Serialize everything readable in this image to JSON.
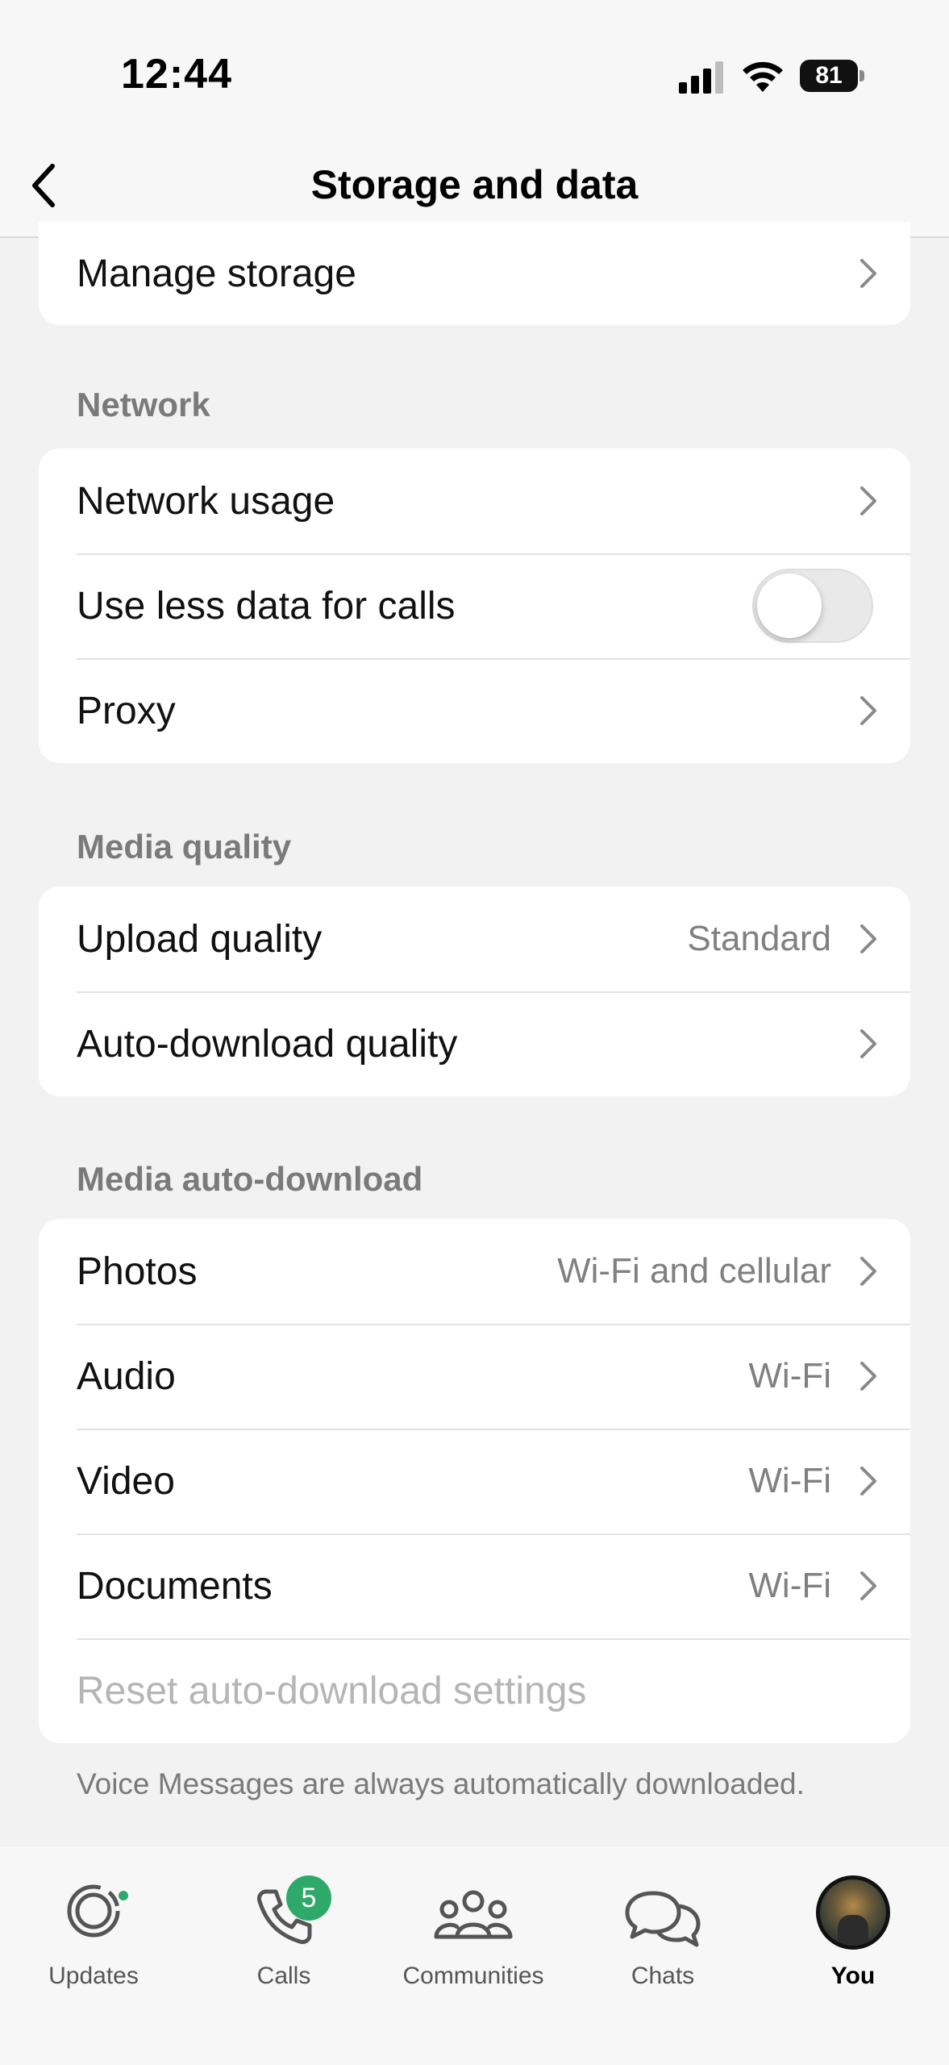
{
  "status_bar": {
    "time": "12:44",
    "battery": "81",
    "icons": [
      "signal-icon",
      "wifi-icon",
      "battery-icon"
    ]
  },
  "nav": {
    "title": "Storage and data",
    "back_icon": "chevron-left-icon"
  },
  "storage_section": {
    "items": [
      {
        "label": "Manage storage"
      }
    ]
  },
  "network_section": {
    "header": "Network",
    "items": [
      {
        "label": "Network usage"
      },
      {
        "label": "Use less data for calls",
        "toggle": false
      },
      {
        "label": "Proxy"
      }
    ]
  },
  "media_quality_section": {
    "header": "Media quality",
    "items": [
      {
        "label": "Upload quality",
        "value": "Standard"
      },
      {
        "label": "Auto-download quality"
      }
    ]
  },
  "auto_download_section": {
    "header": "Media auto-download",
    "items": [
      {
        "label": "Photos",
        "value": "Wi-Fi and cellular"
      },
      {
        "label": "Audio",
        "value": "Wi-Fi"
      },
      {
        "label": "Video",
        "value": "Wi-Fi"
      },
      {
        "label": "Documents",
        "value": "Wi-Fi"
      },
      {
        "label": "Reset auto-download settings",
        "disabled": true
      }
    ],
    "footer": "Voice Messages are always automatically downloaded."
  },
  "tab_bar": {
    "tabs": [
      {
        "label": "Updates",
        "icon": "updates-icon"
      },
      {
        "label": "Calls",
        "icon": "phone-icon",
        "badge": "5"
      },
      {
        "label": "Communities",
        "icon": "communities-icon"
      },
      {
        "label": "Chats",
        "icon": "chats-icon"
      },
      {
        "label": "You",
        "icon": "avatar",
        "active": true
      }
    ]
  },
  "colors": {
    "accent_green": "#2fa96a",
    "background": "#f2f2f2",
    "card": "#ffffff",
    "secondary_text": "#808080"
  }
}
